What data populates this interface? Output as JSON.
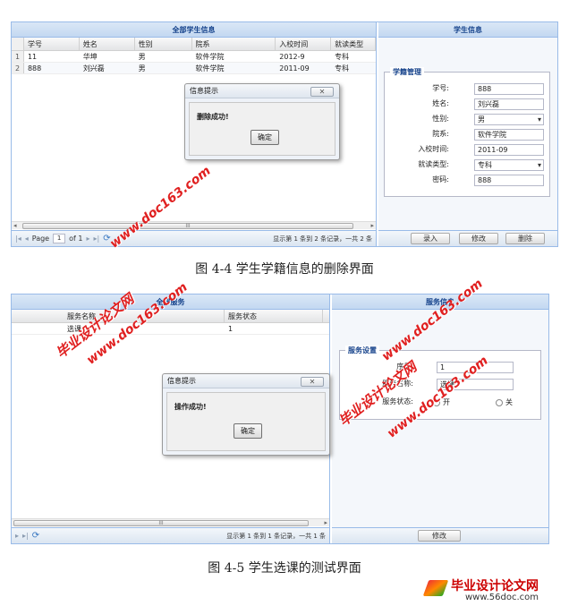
{
  "screen1": {
    "list_panel": {
      "title": "全部学生信息",
      "columns": [
        "学号",
        "姓名",
        "性别",
        "院系",
        "入校时间",
        "就读类型"
      ],
      "rows": [
        {
          "num": "1",
          "cells": [
            "11",
            "华坤",
            "男",
            "软件学院",
            "2012-9",
            "专科"
          ]
        },
        {
          "num": "2",
          "cells": [
            "888",
            "刘兴磊",
            "男",
            "软件学院",
            "2011-09",
            "专科"
          ]
        }
      ],
      "paging": {
        "page_label": "Page",
        "page_value": "1",
        "page_of": "of 1",
        "status": "显示第 1 条到 2 条记录，一共 2 条"
      },
      "scroll_mark": "III"
    },
    "detail_panel": {
      "title": "学生信息",
      "legend": "学籍管理",
      "fields": [
        {
          "label": "学号:",
          "value": "888"
        },
        {
          "label": "姓名:",
          "value": "刘兴磊"
        },
        {
          "label": "性别:",
          "value": "男"
        },
        {
          "label": "院系:",
          "value": "软件学院"
        },
        {
          "label": "入校时间:",
          "value": "2011-09"
        },
        {
          "label": "就读类型:",
          "value": "专科"
        },
        {
          "label": "密码:",
          "value": "888"
        }
      ],
      "buttons": [
        "录入",
        "修改",
        "删除"
      ]
    },
    "dialog": {
      "title": "信息提示",
      "message": "删除成功!",
      "ok": "确定",
      "close": "✕"
    }
  },
  "caption1": "图 4-4  学生学籍信息的删除界面",
  "screen2": {
    "list_panel": {
      "title": "全部服务",
      "columns": [
        "服务名称",
        "服务状态"
      ],
      "rows": [
        {
          "cells": [
            "选课",
            "1"
          ]
        }
      ],
      "paging": {
        "status": "显示第 1 条到 1 条记录，一共 1 条"
      },
      "scroll_mark": "III"
    },
    "detail_panel": {
      "title": "服务信息",
      "legend": "服务设置",
      "fields": [
        {
          "label": "序号:",
          "value": "1"
        },
        {
          "label": "服务名称:",
          "value": "选课"
        }
      ],
      "status_label": "服务状态:",
      "radio_on": "开",
      "radio_off": "关",
      "button": "修改"
    },
    "dialog": {
      "title": "信息提示",
      "message": "操作成功!",
      "ok": "确定",
      "close": "✕"
    }
  },
  "caption2": "图 4-5  学生选课的测试界面",
  "watermarks": {
    "cn": "毕业设计论文网",
    "url": "www.doc163.com",
    "logo_cn": "毕业设计论文网",
    "logo_url": "www.56doc.com"
  }
}
